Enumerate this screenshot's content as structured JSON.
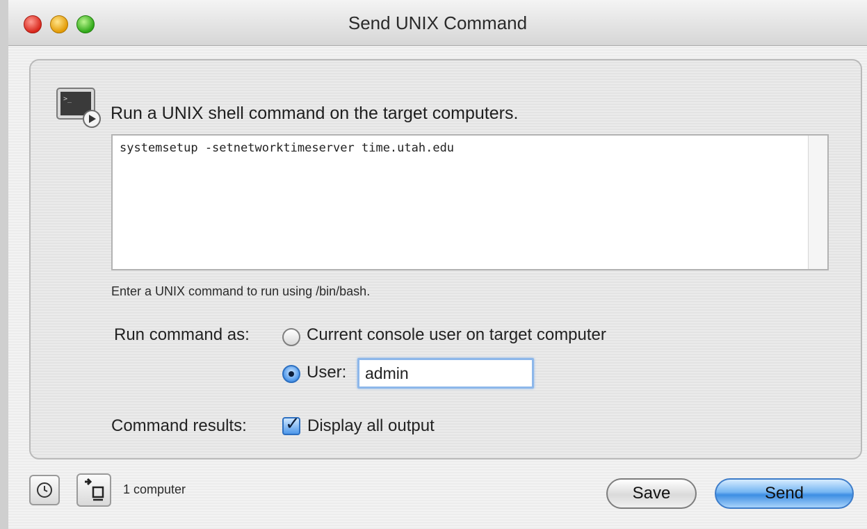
{
  "window": {
    "title": "Send UNIX Command"
  },
  "panel": {
    "heading": "Run a UNIX shell command on the target computers.",
    "command": "systemsetup -setnetworktimeserver time.utah.edu",
    "hint": "Enter a UNIX command to run using /bin/bash.",
    "run_as": {
      "label": "Run command as:",
      "option_console": "Current console user on target computer",
      "option_user": "User:",
      "user_value": "admin",
      "selected": "user"
    },
    "results": {
      "label": "Command results:",
      "option": "Display all output",
      "checked": true
    }
  },
  "footer": {
    "computer_count": "1 computer",
    "save_label": "Save",
    "send_label": "Send"
  },
  "icons": [
    "terminal-icon",
    "clock-icon",
    "add-computer-icon"
  ],
  "colors": {
    "accent": "#3d8ee3",
    "focus_ring": "#8db7ea"
  }
}
